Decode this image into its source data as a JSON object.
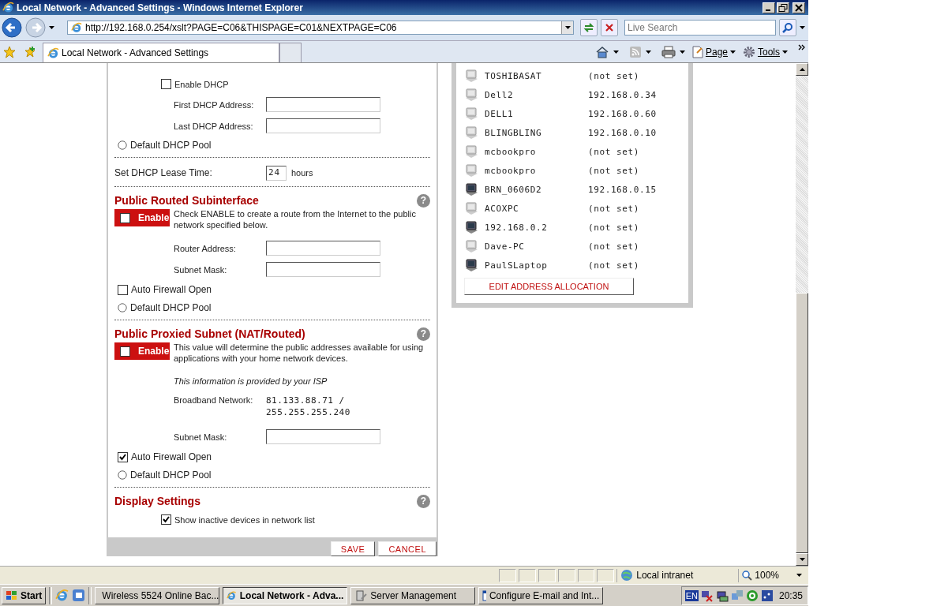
{
  "window": {
    "title": "Local Network - Advanced Settings - Windows Internet Explorer"
  },
  "address_bar": {
    "url": "http://192.168.0.254/xslt?PAGE=C06&THISPAGE=C01&NEXTPAGE=C06"
  },
  "search": {
    "placeholder": "Live Search"
  },
  "tabs": [
    {
      "label": "Local Network - Advanced Settings",
      "selected": true
    }
  ],
  "command_bar": [
    "Page",
    "Tools"
  ],
  "settings_panel": {
    "sections": [
      {
        "items": [
          {
            "kind": "sub_checkbox",
            "label": "Enable DHCP",
            "checked": false
          },
          {
            "kind": "field",
            "label": "First DHCP Address:"
          },
          {
            "kind": "field",
            "label": "Last DHCP Address:"
          },
          {
            "kind": "radio",
            "label": "Default DHCP Pool",
            "selected": false
          }
        ]
      },
      {
        "items": [
          {
            "kind": "lease",
            "label": "Set DHCP Lease Time:",
            "value": "24",
            "unit": "hours"
          }
        ]
      },
      {
        "heading": "Public Routed Subinterface",
        "help": "?",
        "items": [
          {
            "kind": "enable",
            "label": "Enable",
            "checked": false,
            "description": "Check ENABLE to create a route from the Internet to the public network specified below."
          },
          {
            "kind": "field",
            "label": "Router Address:"
          },
          {
            "kind": "field",
            "label": "Subnet Mask:"
          },
          {
            "kind": "checkbox",
            "label": "Auto Firewall Open",
            "checked": false
          },
          {
            "kind": "radio",
            "label": "Default DHCP Pool",
            "selected": false
          }
        ]
      },
      {
        "heading": "Public Proxied Subnet (NAT/Routed)",
        "help": "?",
        "items": [
          {
            "kind": "enable",
            "label": "Enable",
            "checked": false,
            "description": "This value will determine the public addresses available for using applications with your home network devices."
          },
          {
            "kind": "note",
            "text": "This information is provided by your ISP"
          },
          {
            "kind": "readonly",
            "label": "Broadband Network:",
            "lines": [
              "81.133.88.71 /",
              "255.255.255.240"
            ]
          },
          {
            "kind": "field",
            "label": "Subnet Mask:"
          },
          {
            "kind": "checkbox",
            "label": "Auto Firewall Open",
            "checked": true
          },
          {
            "kind": "radio",
            "label": "Default DHCP Pool",
            "selected": false
          }
        ]
      },
      {
        "heading": "Display Settings",
        "help": "?",
        "items": [
          {
            "kind": "sub_checkbox",
            "label": "Show inactive devices in network list",
            "checked": true
          }
        ]
      }
    ]
  },
  "buttons": [
    "SAVE",
    "CANCEL"
  ],
  "devices": {
    "rows": [
      {
        "name": "TOSHIBASAT",
        "address": "(not set)",
        "active": false
      },
      {
        "name": "Dell2",
        "address": "192.168.0.34",
        "active": false
      },
      {
        "name": "DELL1",
        "address": "192.168.0.60",
        "active": false
      },
      {
        "name": "BLINGBLING",
        "address": "192.168.0.10",
        "active": false
      },
      {
        "name": "mcbookpro",
        "address": "(not set)",
        "active": false
      },
      {
        "name": "mcbookpro",
        "address": "(not set)",
        "active": false
      },
      {
        "name": "BRN_0606D2",
        "address": "192.168.0.15",
        "active": true
      },
      {
        "name": "ACOXPC",
        "address": "(not set)",
        "active": false
      },
      {
        "name": "192.168.0.2",
        "address": "(not set)",
        "active": true
      },
      {
        "name": "Dave-PC",
        "address": "(not set)",
        "active": false
      },
      {
        "name": "PaulSLaptop",
        "address": "(not set)",
        "active": true
      }
    ],
    "button": "EDIT ADDRESS ALLOCATION"
  },
  "status_bar": {
    "zone": "Local intranet",
    "zoom": "100%"
  },
  "taskbar": {
    "start": "Start",
    "tasks": [
      {
        "label": "Wireless 5524 Online Bac...",
        "selected": false
      },
      {
        "label": "Local Network - Adva...",
        "selected": true
      },
      {
        "label": "Server Management",
        "selected": false
      },
      {
        "label": "Configure E-mail and Int...",
        "selected": false
      }
    ],
    "language": "EN",
    "clock": "20:35"
  }
}
